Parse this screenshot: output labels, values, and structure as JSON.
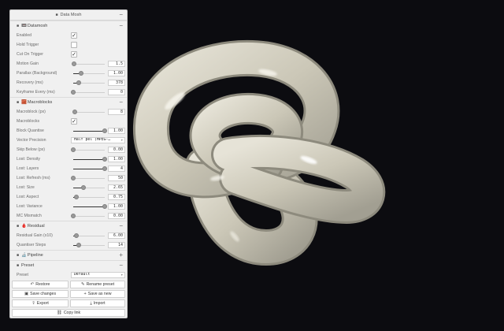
{
  "panel": {
    "title": "Data Mosh",
    "title_icon": "folder-icon",
    "collapse_glyph": "−",
    "expand_glyph": "+"
  },
  "datamosh": {
    "heading": "Datamosh",
    "emoji": "📼",
    "enabled_label": "Enabled",
    "enabled": true,
    "hold_label": "Hold Trigger",
    "hold": false,
    "cut_label": "Cut On Trigger",
    "cut": true,
    "motion_gain": {
      "label": "Motion Gain",
      "value": "1.5",
      "fraction": 0.03
    },
    "parallax": {
      "label": "Parallax (Background)",
      "value": "1.00",
      "fraction": 0.25
    },
    "recovery": {
      "label": "Recovery (ms)",
      "value": "378",
      "fraction": 0.18
    },
    "keyframe": {
      "label": "Keyframe Every (ms)",
      "value": "0",
      "fraction": 0.0
    }
  },
  "macroblocks": {
    "heading": "Macroblocks",
    "emoji": "🧱",
    "macroblock": {
      "label": "Macroblock (px)",
      "value": "8",
      "fraction": 0.06
    },
    "macroblocks_label": "Macroblocks",
    "macroblocks_on": true,
    "quantise": {
      "label": "Block Quantise",
      "value": "1.00",
      "fraction": 1.0
    },
    "vector_precision": {
      "label": "Vector Precision",
      "value": "Half pel (MPEG-…"
    },
    "skip_below": {
      "label": "Skip Below (px)",
      "value": "0.00",
      "fraction": 0.0
    },
    "lost_density": {
      "label": "Lost: Density",
      "value": "1.00",
      "fraction": 1.0
    },
    "lost_layers": {
      "label": "Lost: Layers",
      "value": "4",
      "fraction": 1.0
    },
    "lost_refresh": {
      "label": "Lost: Refresh (ms)",
      "value": "50",
      "fraction": 0.0
    },
    "lost_size": {
      "label": "Lost: Size",
      "value": "2.65",
      "fraction": 0.33
    },
    "lost_aspect": {
      "label": "Lost: Aspect",
      "value": "0.75",
      "fraction": 0.1
    },
    "lost_variance": {
      "label": "Lost: Variance",
      "value": "1.00",
      "fraction": 1.0
    },
    "mc_mismatch": {
      "label": "MC Mismatch",
      "value": "0.00",
      "fraction": 0.0
    }
  },
  "residual": {
    "heading": "Residual",
    "emoji": "🩸",
    "gain": {
      "label": "Residual Gain (x10)",
      "value": "6.00",
      "fraction": 0.1
    },
    "steps": {
      "label": "Quantiser Steps",
      "value": "14",
      "fraction": 0.17
    }
  },
  "pipeline": {
    "heading": "Pipeline",
    "emoji": "🔬"
  },
  "preset": {
    "heading": "Preset",
    "preset_label": "Preset",
    "preset_value": "Default",
    "restore": "Restore",
    "rename": "Rename preset",
    "save_changes": "Save changes",
    "save_new": "Save as new",
    "export": "Export",
    "import": "Import",
    "copy_link": "Copy link"
  },
  "colors": {
    "background": "#0c0c10",
    "knot_base": "#cbc7b7",
    "knot_highlight": "#f6f4ec",
    "knot_shadow": "#8d8a7d"
  }
}
